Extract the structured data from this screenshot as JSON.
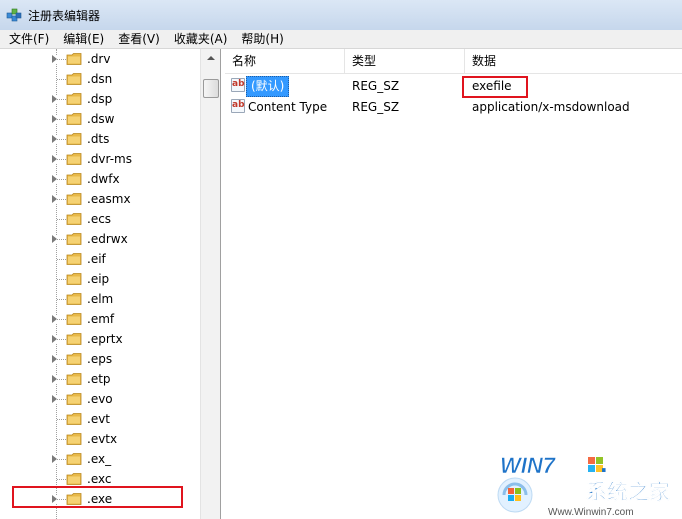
{
  "window": {
    "title": "注册表编辑器"
  },
  "menu": [
    {
      "label": "文件(F)"
    },
    {
      "label": "编辑(E)"
    },
    {
      "label": "查看(V)"
    },
    {
      "label": "收藏夹(A)"
    },
    {
      "label": "帮助(H)"
    }
  ],
  "tree": {
    "items": [
      {
        "label": ".drv",
        "expandable": true
      },
      {
        "label": ".dsn",
        "expandable": false
      },
      {
        "label": ".dsp",
        "expandable": true
      },
      {
        "label": ".dsw",
        "expandable": true
      },
      {
        "label": ".dts",
        "expandable": true
      },
      {
        "label": ".dvr-ms",
        "expandable": true
      },
      {
        "label": ".dwfx",
        "expandable": true
      },
      {
        "label": ".easmx",
        "expandable": true
      },
      {
        "label": ".ecs",
        "expandable": false
      },
      {
        "label": ".edrwx",
        "expandable": true
      },
      {
        "label": ".eif",
        "expandable": false
      },
      {
        "label": ".eip",
        "expandable": false
      },
      {
        "label": ".elm",
        "expandable": false
      },
      {
        "label": ".emf",
        "expandable": true
      },
      {
        "label": ".eprtx",
        "expandable": true
      },
      {
        "label": ".eps",
        "expandable": true
      },
      {
        "label": ".etp",
        "expandable": true
      },
      {
        "label": ".evo",
        "expandable": true
      },
      {
        "label": ".evt",
        "expandable": false
      },
      {
        "label": ".evtx",
        "expandable": false
      },
      {
        "label": ".ex_",
        "expandable": true
      },
      {
        "label": ".exc",
        "expandable": false
      },
      {
        "label": ".exe",
        "expandable": true,
        "highlighted": true
      }
    ]
  },
  "values": {
    "columns": [
      "名称",
      "类型",
      "数据"
    ],
    "rows": [
      {
        "name": "(默认)",
        "type": "REG_SZ",
        "data": "exefile",
        "selected": true,
        "icon": "string-value-icon"
      },
      {
        "name": "Content Type",
        "type": "REG_SZ",
        "data": "application/x-msdownload",
        "selected": false,
        "icon": "string-value-icon"
      }
    ]
  },
  "watermark": {
    "brand": "WIN7",
    "tagline": "系统之家",
    "url": "Www.Winwin7.com"
  },
  "colors": {
    "highlight": "#e0141e",
    "selection": "#3399ff",
    "folder": "#e8b949"
  }
}
